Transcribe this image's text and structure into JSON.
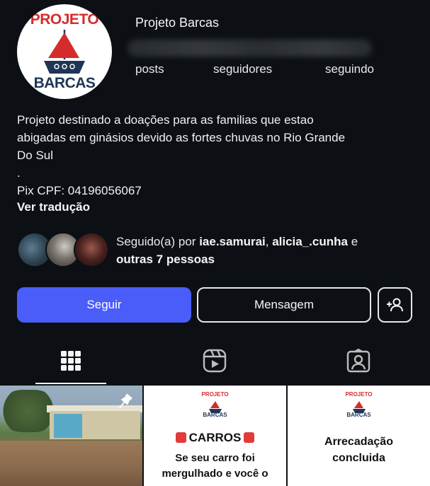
{
  "profile": {
    "username": "Projeto Barcas",
    "avatar_logo_top": "PROJETO",
    "avatar_logo_bottom": "BARCAS",
    "stats": {
      "posts_label": "posts",
      "followers_label": "seguidores",
      "following_label": "seguindo"
    },
    "bio_lines": [
      "Projeto destinado a doações para as familias que estao",
      "abigadas em ginásios devido as fortes chuvas no Rio Grande",
      "Do Sul",
      ".",
      "Pix CPF: 04196056067"
    ],
    "translate_link": "Ver tradução"
  },
  "followed_by": {
    "prefix": "Seguido(a) por ",
    "user1": "iae.samurai",
    "separator": ", ",
    "user2": "alicia_.cunha",
    "conjunction": " e",
    "others": "outras 7 pessoas"
  },
  "actions": {
    "follow_label": "Seguir",
    "message_label": "Mensagem"
  },
  "tabs": {
    "icons": [
      "grid-icon",
      "reels-icon",
      "tagged-icon"
    ],
    "active": "grid-icon"
  },
  "posts": {
    "card_logo_top": "PROJETO",
    "card_logo_bottom": "BARCAS",
    "post2_title": "CARROS",
    "post2_body_line1": "Se seu carro foi",
    "post2_body_line2": "mergulhado e você o",
    "post3_line1": "Arrecadação",
    "post3_line2": "concluida"
  },
  "colors": {
    "background": "#0c1014",
    "follow_button": "#4a5df9",
    "logo_red": "#d62b2b",
    "logo_navy": "#1f3556"
  }
}
